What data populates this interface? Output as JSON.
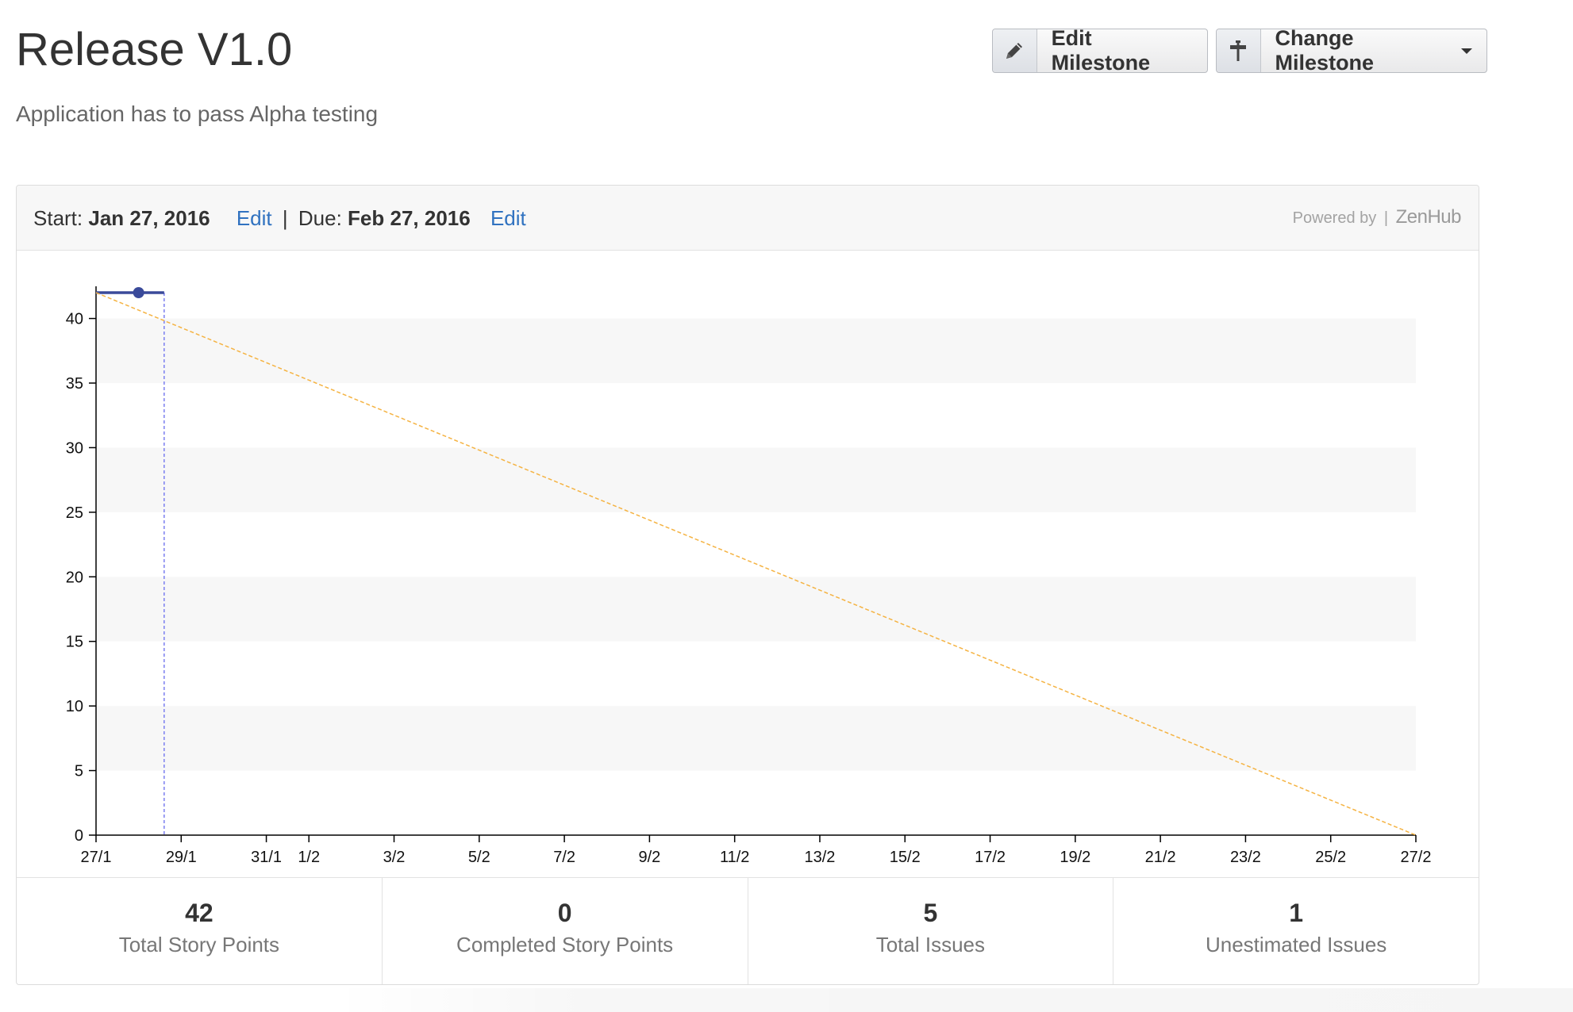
{
  "milestone": {
    "title": "Release V1.0",
    "description": "Application has to pass Alpha testing"
  },
  "toolbar": {
    "edit_label": "Edit Milestone",
    "change_label": "Change Milestone",
    "edit_icon": "pencil-icon",
    "change_icon": "signpost-icon"
  },
  "dates": {
    "start_label": "Start:",
    "start_value": "Jan 27, 2016",
    "edit_start": "Edit",
    "separator": "|",
    "due_label": "Due:",
    "due_value": "Feb 27, 2016",
    "edit_due": "Edit"
  },
  "powered": {
    "prefix": "Powered by",
    "brand": "ZenHub"
  },
  "colors": {
    "actual": "#3a4a9a",
    "ideal": "#f5b342",
    "today": "#7b7ff0",
    "band": "#f7f7f7",
    "link": "#3072c0"
  },
  "chart_data": {
    "type": "line",
    "x_ticks": [
      "27/1",
      "29/1",
      "31/1",
      "1/2",
      "3/2",
      "5/2",
      "7/2",
      "9/2",
      "11/2",
      "13/2",
      "15/2",
      "17/2",
      "19/2",
      "21/2",
      "23/2",
      "25/2",
      "27/2"
    ],
    "y_ticks": [
      0,
      5,
      10,
      15,
      20,
      25,
      30,
      35,
      40
    ],
    "xlim": [
      "2016-01-27",
      "2016-02-27"
    ],
    "ylim": [
      0,
      42
    ],
    "series": [
      {
        "style": "solid",
        "x": [
          "2016-01-27",
          "2016-01-28",
          "2016-01-28.6"
        ],
        "y": [
          42,
          42,
          42
        ],
        "marker_x": "2016-01-28",
        "color": "#3a4a9a"
      },
      {
        "style": "dashed",
        "x": [
          "2016-01-27",
          "2016-02-27"
        ],
        "y": [
          42,
          0
        ],
        "color": "#f5b342"
      }
    ],
    "today_marker": "2016-01-28.6",
    "grid": "alternating bands"
  },
  "stats": [
    {
      "value": "42",
      "label": "Total Story Points"
    },
    {
      "value": "0",
      "label": "Completed Story Points"
    },
    {
      "value": "5",
      "label": "Total Issues"
    },
    {
      "value": "1",
      "label": "Unestimated Issues"
    }
  ]
}
